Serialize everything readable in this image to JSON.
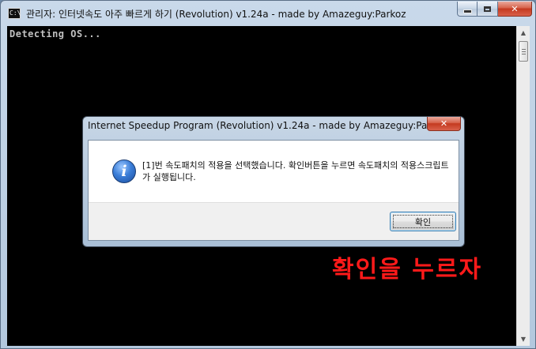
{
  "window": {
    "title": "관리자:  인터넷속도 아주 빠르게 하기 (Revolution) v1.24a - made by Amazeguy:Parkoz",
    "icon_label": "C:\\",
    "buttons": {
      "minimize": "minimize-icon",
      "maximize": "maximize-icon",
      "close": "close-icon"
    }
  },
  "console": {
    "text": "Detecting OS..."
  },
  "dialog": {
    "title": "Internet Speedup Program (Revolution) v1.24a - made by Amazeguy:Parkoz",
    "icon": "info-icon",
    "message": "[1]번 속도패치의 적용을 선택했습니다. 확인버튼을 누르면 속도패치의 적용스크립트가 실행됩니다.",
    "ok_label": "확인"
  },
  "annotation": {
    "text": "확인을 누르자",
    "color": "#ff1a1a"
  }
}
